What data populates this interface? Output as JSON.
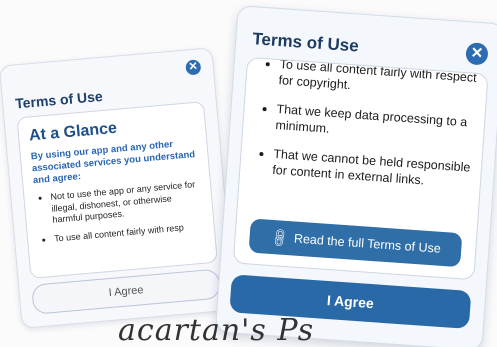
{
  "back_card": {
    "title": "Terms of Use",
    "close_glyph": "✕",
    "heading": "At a Glance",
    "intro": "By using our app and any other associated services you understand and agree:",
    "items": [
      "Not to use the app or any service for illegal, dishonest, or otherwise harmful purposes.",
      "To use all content fairly with resp"
    ],
    "agree_label": "I Agree"
  },
  "front_card": {
    "title": "Terms of Use",
    "close_glyph": "✕",
    "items": [
      "To use all content fairly with respect for copyright.",
      "That we keep data processing to a minimum.",
      "That we cannot be held responsible for content in external links."
    ],
    "read_label": "Read the full Terms of Use",
    "link_icon": "link-icon",
    "agree_label": "I Agree"
  },
  "handwriting": "acartan's Ps",
  "colors": {
    "accent": "#2a69a8",
    "title": "#1e3b63",
    "heading": "#1d4f8a",
    "intro": "#2a66b0"
  }
}
